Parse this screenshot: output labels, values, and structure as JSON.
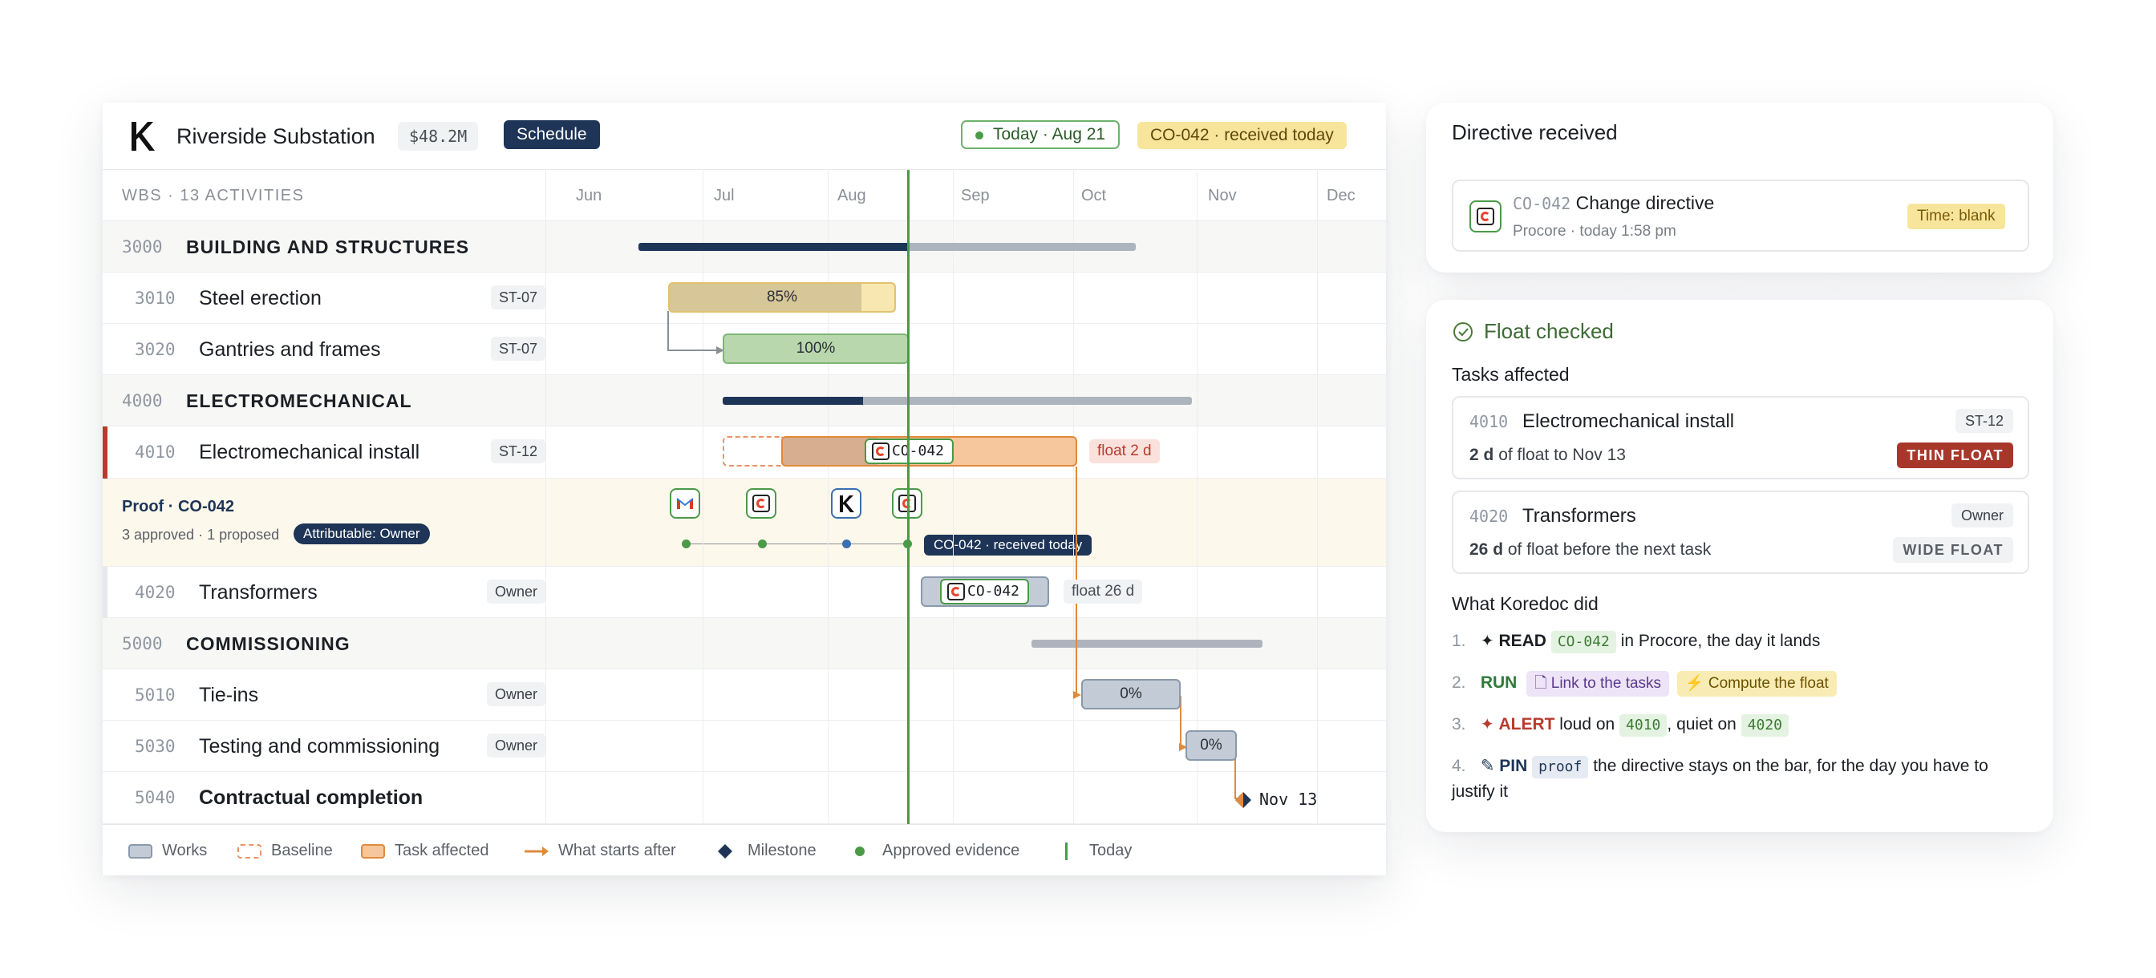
{
  "header": {
    "title": "Riverside Substation",
    "budget": "$48.2M",
    "view": "Schedule",
    "today": "Today · Aug 21",
    "alert": "CO-042 · received today"
  },
  "columns": {
    "wbs_label": "WBS · 13 ACTIVITIES",
    "months": [
      "Jun",
      "Jul",
      "Aug",
      "Sep",
      "Oct",
      "Nov",
      "Dec"
    ]
  },
  "rows": [
    {
      "code": "3000",
      "name": "BUILDING AND STRUCTURES",
      "group": true
    },
    {
      "code": "3010",
      "name": "Steel erection",
      "tag": "ST-07",
      "progress": "85%"
    },
    {
      "code": "3020",
      "name": "Gantries and frames",
      "tag": "ST-07",
      "progress": "100%"
    },
    {
      "code": "4000",
      "name": "ELECTROMECHANICAL",
      "group": true
    },
    {
      "code": "4010",
      "name": "Electromechanical install",
      "tag": "ST-12",
      "chip": "CO-042",
      "float": "float 2 d"
    },
    {
      "code": "4020",
      "name": "Transformers",
      "tag": "Owner",
      "chip": "CO-042",
      "float": "float 26 d"
    },
    {
      "code": "5000",
      "name": "COMMISSIONING",
      "group": true
    },
    {
      "code": "5010",
      "name": "Tie-ins",
      "tag": "Owner",
      "progress": "0%"
    },
    {
      "code": "5030",
      "name": "Testing and commissioning",
      "tag": "Owner",
      "progress": "0%"
    },
    {
      "code": "5040",
      "name": "Contractual completion",
      "milestone": "Nov 13"
    }
  ],
  "proof": {
    "title": "Proof · CO-042",
    "summary": "3 approved · 1 proposed",
    "badge": "Attributable: Owner",
    "tag": "CO-042 · received today"
  },
  "legend": [
    "Works",
    "Baseline",
    "Task affected",
    "What starts after",
    "Milestone",
    "Approved evidence",
    "Today"
  ],
  "directive": {
    "title": "Directive received",
    "code": "CO-042",
    "name": "Change directive",
    "source": "Procore · today 1:58 pm",
    "badge": "Time: blank"
  },
  "float_card": {
    "title": "Float checked",
    "affected_label": "Tasks affected",
    "tasks": [
      {
        "code": "4010",
        "name": "Electromechanical install",
        "tag": "ST-12",
        "days": "2 d",
        "detail": "of float to Nov 13",
        "badge": "THIN FLOAT"
      },
      {
        "code": "4020",
        "name": "Transformers",
        "tag": "Owner",
        "days": "26 d",
        "detail": "of float before the next task",
        "badge": "WIDE FLOAT"
      }
    ],
    "did_label": "What Koredoc did",
    "steps": [
      {
        "num": "1.",
        "verb": "READ",
        "code": "CO-042",
        "text": "in Procore, the day it lands"
      },
      {
        "num": "2.",
        "verb": "RUN",
        "link": "Link to the tasks",
        "compute": "Compute the float"
      },
      {
        "num": "3.",
        "verb": "ALERT",
        "pre": "loud on",
        "code1": "4010",
        "mid": ", quiet on",
        "code2": "4020"
      },
      {
        "num": "4.",
        "verb": "PIN",
        "code": "proof",
        "text": "the directive stays on the bar, for the day you have to justify it"
      }
    ]
  },
  "colors": {
    "navy": "#1e3557",
    "today_green": "#4a9a48",
    "affected": "#f6c79c",
    "thin_float": "#a8372b",
    "alert_yellow": "#f8e59c"
  }
}
